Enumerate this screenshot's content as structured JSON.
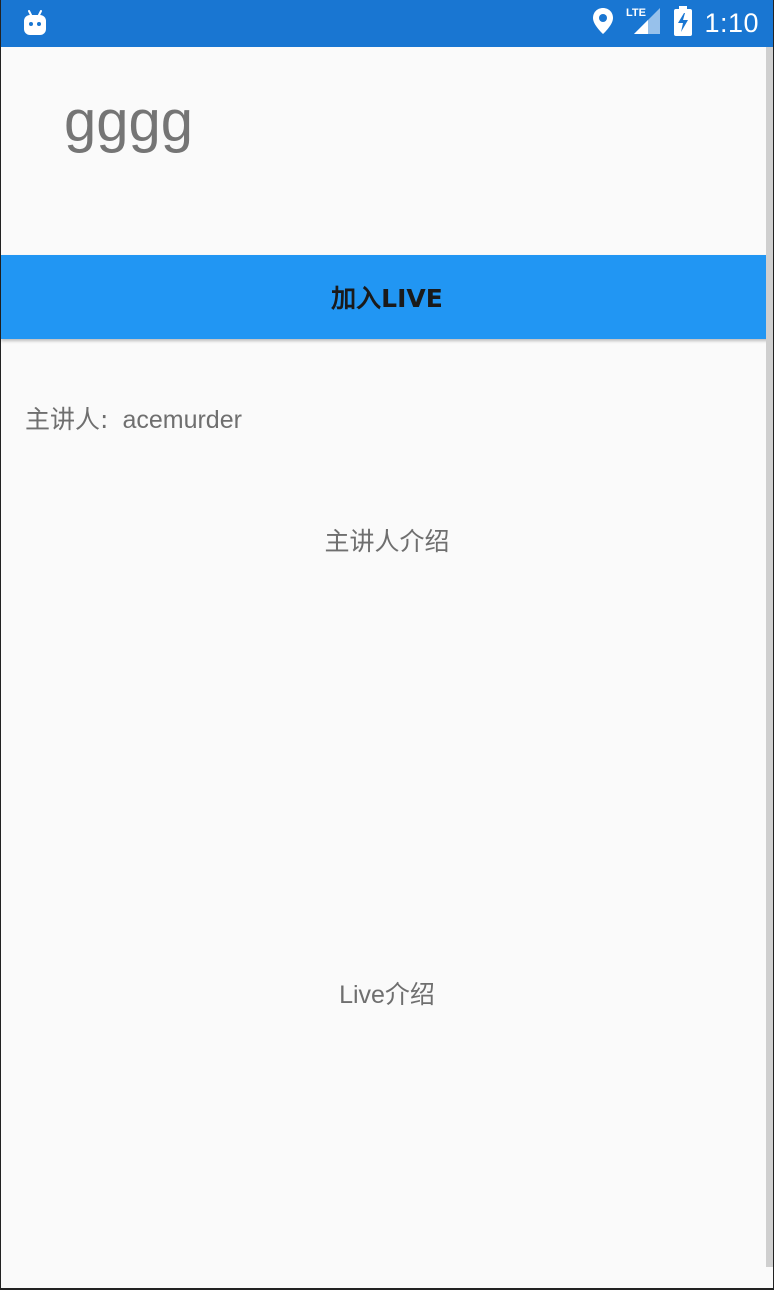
{
  "status_bar": {
    "time": "1:10",
    "network": "LTE",
    "icons": [
      "android-debug-icon",
      "location-icon",
      "lte-signal-icon",
      "battery-charging-icon"
    ],
    "background_color": "#1976d2"
  },
  "page": {
    "title": "gggg"
  },
  "join_button": {
    "label": "加入LIVE",
    "background_color": "#2196f3"
  },
  "speaker": {
    "label": "主讲人:",
    "name": "acemurder"
  },
  "speaker_intro": "主讲人介绍",
  "live_intro": "Live介绍"
}
